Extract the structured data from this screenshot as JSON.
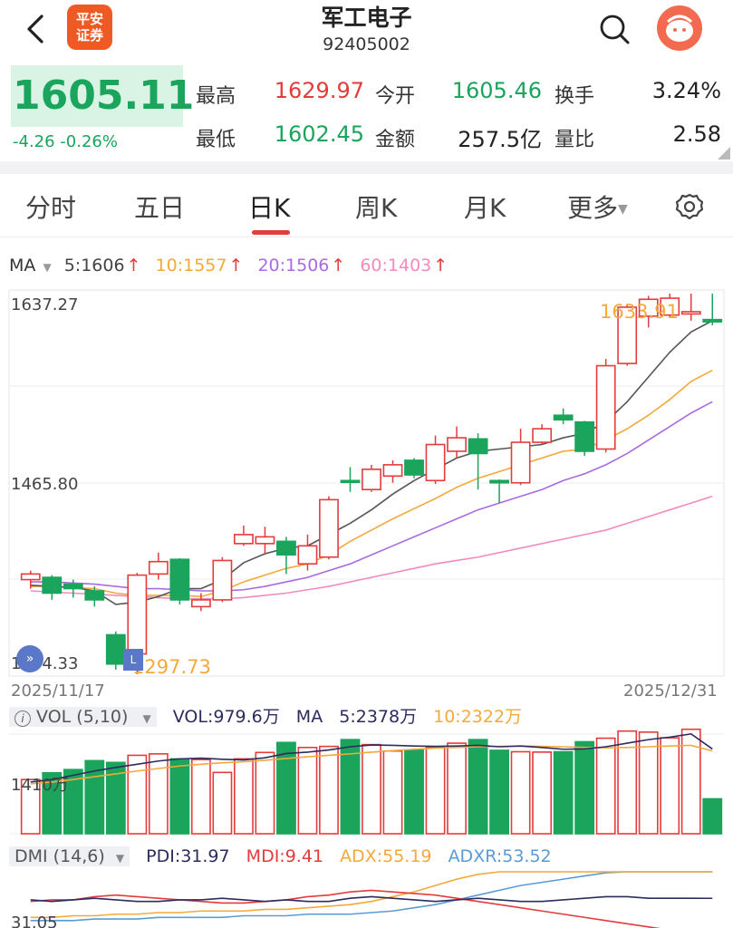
{
  "header": {
    "logo_line1": "平安",
    "logo_line2": "证券",
    "name": "军工电子",
    "code": "92405002"
  },
  "quote": {
    "price": "1605.11",
    "change": "-4.26 -0.26%",
    "high_label": "最高",
    "high": "1629.97",
    "open_label": "今开",
    "open": "1605.46",
    "turnover_label": "换手",
    "turnover": "3.24%",
    "low_label": "最低",
    "low": "1602.45",
    "amount_label": "金额",
    "amount": "257.5亿",
    "vol_ratio_label": "量比",
    "vol_ratio": "2.58"
  },
  "tabs": [
    {
      "label": "分时"
    },
    {
      "label": "五日"
    },
    {
      "label": "日K"
    },
    {
      "label": "周K"
    },
    {
      "label": "月K"
    },
    {
      "label": "更多"
    }
  ],
  "ma": {
    "label": "MA",
    "ma5": "5:1606",
    "ma10": "10:1557",
    "ma20": "20:1506",
    "ma60": "60:1403",
    "up_arrow": "↑"
  },
  "kchart": {
    "y_top": "1637.27",
    "y_mid": "1465.80",
    "y_bottom": "1294.33",
    "date_start": "2025/11/17",
    "date_end": "2025/12/31",
    "max_label": "1633.91",
    "min_label": "1297.73"
  },
  "volume": {
    "selector": "VOL (5,10)",
    "vol": "VOL:979.6万",
    "ma_label": "MA",
    "ma5": "5:2378万",
    "ma10": "10:2322万",
    "y_label": "1410万"
  },
  "dmi": {
    "selector": "DMI (14,6)",
    "pdi": "PDI:31.97",
    "mdi": "MDI:9.41",
    "adx": "ADX:55.19",
    "adxr": "ADXR:53.52",
    "y_label": "31.05"
  },
  "colors": {
    "up": "#e43b3b",
    "down": "#1aa45c",
    "ma5": "#555555",
    "ma10": "#f3a93b",
    "ma20": "#a86be0",
    "ma60": "#f28bbd"
  },
  "chart_data": {
    "type": "candlestick",
    "ohlc": [
      {
        "o": 1380,
        "h": 1388,
        "l": 1372,
        "c": 1385
      },
      {
        "o": 1382,
        "h": 1384,
        "l": 1362,
        "c": 1368
      },
      {
        "o": 1376,
        "h": 1380,
        "l": 1364,
        "c": 1372
      },
      {
        "o": 1370,
        "h": 1374,
        "l": 1356,
        "c": 1362
      },
      {
        "o": 1331,
        "h": 1334,
        "l": 1300,
        "c": 1305
      },
      {
        "o": 1314,
        "h": 1386,
        "l": 1296,
        "c": 1384
      },
      {
        "o": 1385,
        "h": 1404,
        "l": 1380,
        "c": 1396
      },
      {
        "o": 1398,
        "h": 1399,
        "l": 1358,
        "c": 1362
      },
      {
        "o": 1356,
        "h": 1368,
        "l": 1352,
        "c": 1362
      },
      {
        "o": 1362,
        "h": 1400,
        "l": 1360,
        "c": 1397
      },
      {
        "o": 1412,
        "h": 1428,
        "l": 1410,
        "c": 1420
      },
      {
        "o": 1412,
        "h": 1427,
        "l": 1402,
        "c": 1418
      },
      {
        "o": 1414,
        "h": 1418,
        "l": 1385,
        "c": 1402
      },
      {
        "o": 1394,
        "h": 1420,
        "l": 1388,
        "c": 1410
      },
      {
        "o": 1400,
        "h": 1454,
        "l": 1398,
        "c": 1451
      },
      {
        "o": 1468,
        "h": 1480,
        "l": 1458,
        "c": 1467
      },
      {
        "o": 1460,
        "h": 1482,
        "l": 1458,
        "c": 1478
      },
      {
        "o": 1472,
        "h": 1486,
        "l": 1466,
        "c": 1482
      },
      {
        "o": 1486,
        "h": 1488,
        "l": 1470,
        "c": 1473
      },
      {
        "o": 1468,
        "h": 1508,
        "l": 1465,
        "c": 1500
      },
      {
        "o": 1494,
        "h": 1516,
        "l": 1488,
        "c": 1506
      },
      {
        "o": 1505,
        "h": 1510,
        "l": 1460,
        "c": 1492
      },
      {
        "o": 1468,
        "h": 1469,
        "l": 1448,
        "c": 1466
      },
      {
        "o": 1466,
        "h": 1514,
        "l": 1464,
        "c": 1502
      },
      {
        "o": 1502,
        "h": 1518,
        "l": 1500,
        "c": 1514
      },
      {
        "o": 1526,
        "h": 1532,
        "l": 1518,
        "c": 1522
      },
      {
        "o": 1520,
        "h": 1521,
        "l": 1490,
        "c": 1494
      },
      {
        "o": 1496,
        "h": 1576,
        "l": 1493,
        "c": 1570
      },
      {
        "o": 1572,
        "h": 1625,
        "l": 1570,
        "c": 1622
      },
      {
        "o": 1614,
        "h": 1632,
        "l": 1604,
        "c": 1629
      },
      {
        "o": 1615,
        "h": 1634,
        "l": 1613,
        "c": 1630
      },
      {
        "o": 1616,
        "h": 1634,
        "l": 1610,
        "c": 1618
      },
      {
        "o": 1611,
        "h": 1634,
        "l": 1606,
        "c": 1609
      }
    ],
    "ma5": [
      1375,
      1374,
      1373,
      1370,
      1358,
      1360,
      1365,
      1372,
      1372,
      1380,
      1395,
      1403,
      1408,
      1410,
      1420,
      1430,
      1442,
      1456,
      1468,
      1478,
      1488,
      1494,
      1496,
      1498,
      1500,
      1506,
      1510,
      1520,
      1538,
      1560,
      1582,
      1600,
      1610
    ],
    "ma10": [
      1374,
      1374,
      1373,
      1372,
      1368,
      1366,
      1366,
      1366,
      1365,
      1370,
      1378,
      1384,
      1390,
      1394,
      1402,
      1414,
      1424,
      1434,
      1443,
      1452,
      1462,
      1470,
      1476,
      1482,
      1488,
      1494,
      1496,
      1504,
      1514,
      1526,
      1540,
      1556,
      1566
    ],
    "ma20": [
      1378,
      1378,
      1377,
      1376,
      1374,
      1372,
      1372,
      1371,
      1370,
      1370,
      1371,
      1374,
      1378,
      1382,
      1388,
      1394,
      1402,
      1410,
      1418,
      1426,
      1434,
      1442,
      1448,
      1454,
      1460,
      1468,
      1474,
      1482,
      1492,
      1504,
      1516,
      1528,
      1538
    ],
    "ma60": [
      1370,
      1369,
      1368,
      1367,
      1366,
      1365,
      1364,
      1363,
      1363,
      1363,
      1364,
      1366,
      1368,
      1371,
      1374,
      1378,
      1382,
      1386,
      1390,
      1394,
      1397,
      1400,
      1404,
      1408,
      1412,
      1416,
      1420,
      1424,
      1430,
      1436,
      1442,
      1448,
      1454
    ],
    "volume": [
      1520,
      1710,
      1800,
      2050,
      2000,
      2200,
      2240,
      2100,
      2080,
      1720,
      2100,
      2280,
      2560,
      2420,
      2450,
      2640,
      2500,
      2320,
      2350,
      2420,
      2540,
      2640,
      2340,
      2300,
      2290,
      2300,
      2580,
      2680,
      2880,
      2850,
      2690,
      2930,
      979.6
    ],
    "vol_ma5": [
      1450,
      1520,
      1640,
      1760,
      1860,
      1950,
      2040,
      2100,
      2120,
      2090,
      2070,
      2130,
      2250,
      2290,
      2350,
      2440,
      2490,
      2480,
      2460,
      2450,
      2460,
      2480,
      2440,
      2460,
      2420,
      2370,
      2380,
      2440,
      2540,
      2640,
      2710,
      2800,
      2378
    ],
    "vol_ma10": [
      1400,
      1450,
      1520,
      1600,
      1680,
      1760,
      1830,
      1900,
      1950,
      1990,
      2020,
      2060,
      2110,
      2160,
      2200,
      2240,
      2290,
      2330,
      2370,
      2400,
      2420,
      2440,
      2450,
      2460,
      2450,
      2440,
      2420,
      2410,
      2420,
      2440,
      2460,
      2480,
      2322
    ],
    "dmi_pdi": [
      31,
      30,
      31,
      32,
      31,
      30,
      30,
      31,
      31,
      32,
      31,
      30,
      31,
      30,
      30,
      32,
      33,
      32,
      31,
      30,
      31,
      32,
      31,
      30,
      30,
      31,
      32,
      33,
      33,
      32,
      32,
      32,
      31.97
    ],
    "dmi_mdi": [
      30,
      31,
      31,
      33,
      34,
      33,
      32,
      31,
      30,
      29,
      29,
      30,
      31,
      33,
      34,
      36,
      37,
      36,
      35,
      34,
      32,
      30,
      28,
      26,
      24,
      22,
      20,
      18,
      16,
      14,
      12,
      11,
      9.41
    ],
    "dmi_adx": [
      20,
      20,
      21,
      21,
      22,
      22,
      23,
      23,
      24,
      24,
      24,
      25,
      25,
      26,
      27,
      28,
      30,
      33,
      36,
      40,
      44,
      47,
      50,
      51,
      51,
      52,
      53,
      54,
      54,
      55,
      55,
      55,
      55.19
    ],
    "dmi_adxr": [
      18,
      18,
      18,
      19,
      19,
      19,
      20,
      20,
      20,
      20,
      21,
      21,
      21,
      22,
      22,
      22,
      23,
      24,
      26,
      28,
      31,
      34,
      37,
      40,
      42,
      44,
      46,
      48,
      50,
      51,
      52,
      53,
      53.52
    ]
  }
}
